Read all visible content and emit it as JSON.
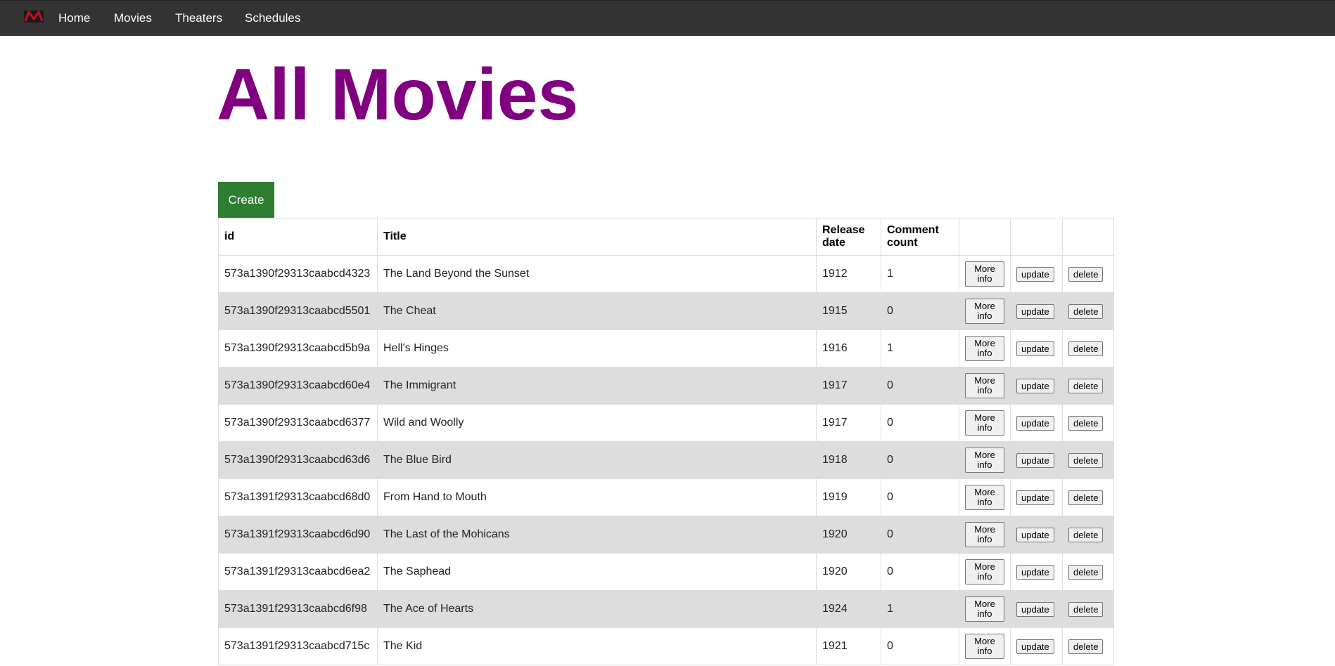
{
  "nav": {
    "logo_color": "#c0102a",
    "items": [
      {
        "label": "Home"
      },
      {
        "label": "Movies"
      },
      {
        "label": "Theaters"
      },
      {
        "label": "Schedules"
      }
    ]
  },
  "page": {
    "title": "All Movies",
    "title_color": "#800080",
    "create_label": "Create",
    "create_color": "#2e7d32"
  },
  "table": {
    "headers": {
      "id": "id",
      "title": "Title",
      "release": "Release date",
      "comments": "Comment count"
    },
    "more_label": "More info",
    "update_label": "update",
    "delete_label": "delete",
    "rows": [
      {
        "id": "573a1390f29313caabcd4323",
        "title": "The Land Beyond the Sunset",
        "year": "1912",
        "comments": "1"
      },
      {
        "id": "573a1390f29313caabcd5501",
        "title": "The Cheat",
        "year": "1915",
        "comments": "0"
      },
      {
        "id": "573a1390f29313caabcd5b9a",
        "title": "Hell's Hinges",
        "year": "1916",
        "comments": "1"
      },
      {
        "id": "573a1390f29313caabcd60e4",
        "title": "The Immigrant",
        "year": "1917",
        "comments": "0"
      },
      {
        "id": "573a1390f29313caabcd6377",
        "title": "Wild and Woolly",
        "year": "1917",
        "comments": "0"
      },
      {
        "id": "573a1390f29313caabcd63d6",
        "title": "The Blue Bird",
        "year": "1918",
        "comments": "0"
      },
      {
        "id": "573a1391f29313caabcd68d0",
        "title": "From Hand to Mouth",
        "year": "1919",
        "comments": "0"
      },
      {
        "id": "573a1391f29313caabcd6d90",
        "title": "The Last of the Mohicans",
        "year": "1920",
        "comments": "0"
      },
      {
        "id": "573a1391f29313caabcd6ea2",
        "title": "The Saphead",
        "year": "1920",
        "comments": "0"
      },
      {
        "id": "573a1391f29313caabcd6f98",
        "title": "The Ace of Hearts",
        "year": "1924",
        "comments": "1"
      },
      {
        "id": "573a1391f29313caabcd715c",
        "title": "The Kid",
        "year": "1921",
        "comments": "0"
      }
    ]
  }
}
